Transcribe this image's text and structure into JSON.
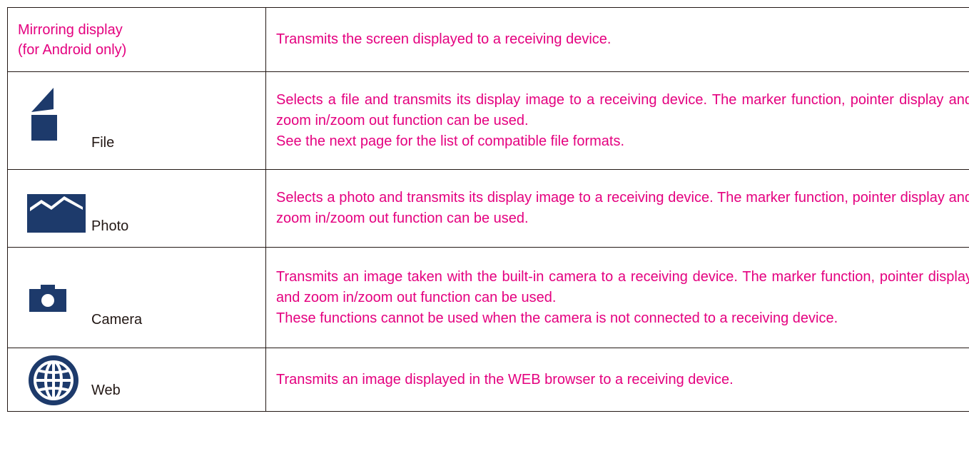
{
  "rows": [
    {
      "feature": "Mirroring display\n(for Android only)",
      "description": "Transmits the screen displayed to a receiving device."
    },
    {
      "icon": "file-icon",
      "feature": "File",
      "description": "Selects a file and transmits its display image to a receiving device. The marker function, pointer display and zoom in/zoom out function can be used.\nSee the next page for the list of compatible file formats."
    },
    {
      "icon": "photo-icon",
      "feature": "Photo",
      "description": "Selects a photo and transmits its display image to a receiving device. The marker function, pointer display and zoom in/zoom out function can be used."
    },
    {
      "icon": "camera-icon",
      "feature": "Camera",
      "description": "Transmits an image taken with the built-in camera to a receiving device. The marker function, pointer display and zoom in/zoom out function can be used.\nThese functions cannot be used when the camera is not connected to a receiving device."
    },
    {
      "icon": "globe-icon",
      "feature": "Web",
      "description": "Transmits an image displayed in the WEB browser to a receiving device."
    }
  ],
  "colors": {
    "accent_text": "#e4007f",
    "icon_fill": "#1d3a6b",
    "body_text": "#231815",
    "border": "#231815"
  }
}
